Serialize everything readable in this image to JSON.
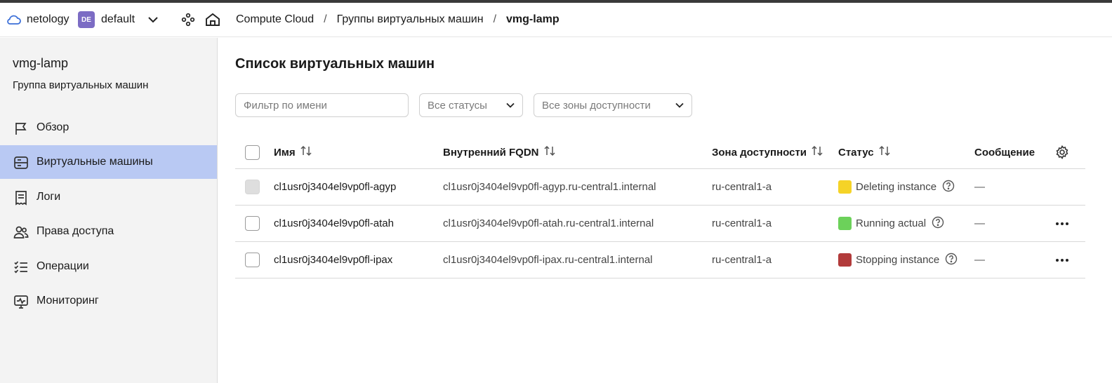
{
  "topbar": {
    "org": "netology",
    "folder_badge": "DE",
    "folder": "default",
    "breadcrumb": [
      "Compute Cloud",
      "Группы виртуальных машин",
      "vmg-lamp"
    ]
  },
  "sidebar": {
    "title": "vmg-lamp",
    "subtitle": "Группа виртуальных машин",
    "items": [
      {
        "label": "Обзор",
        "icon": "flag-icon"
      },
      {
        "label": "Виртуальные машины",
        "icon": "server-icon",
        "active": true
      },
      {
        "label": "Логи",
        "icon": "log-icon"
      },
      {
        "label": "Права доступа",
        "icon": "users-icon"
      },
      {
        "label": "Операции",
        "icon": "list-check-icon"
      },
      {
        "label": "Мониторинг",
        "icon": "monitor-pulse-icon"
      }
    ]
  },
  "main": {
    "title": "Список виртуальных машин",
    "filters": {
      "name_placeholder": "Фильтр по имени",
      "status_value": "Все статусы",
      "zone_value": "Все зоны доступности"
    },
    "table": {
      "columns": [
        "Имя",
        "Внутренний FQDN",
        "Зона доступности",
        "Статус",
        "Сообщение"
      ],
      "rows": [
        {
          "name": "cl1usr0j3404el9vp0fl-agyp",
          "fqdn": "cl1usr0j3404el9vp0fl-agyp.ru-central1.internal",
          "zone": "ru-central1-a",
          "status": "Deleting instance",
          "status_color": "#f5d327",
          "message": "—"
        },
        {
          "name": "cl1usr0j3404el9vp0fl-atah",
          "fqdn": "cl1usr0j3404el9vp0fl-atah.ru-central1.internal",
          "zone": "ru-central1-a",
          "status": "Running actual",
          "status_color": "#6cd15a",
          "message": "—"
        },
        {
          "name": "cl1usr0j3404el9vp0fl-ipax",
          "fqdn": "cl1usr0j3404el9vp0fl-ipax.ru-central1.internal",
          "zone": "ru-central1-a",
          "status": "Stopping instance",
          "status_color": "#b23b3b",
          "message": "—"
        }
      ]
    }
  },
  "colors": {
    "active_nav": "#b9c9f3",
    "folder_badge": "#7c6cc4",
    "sidebar_bg": "#f3f3f3"
  }
}
